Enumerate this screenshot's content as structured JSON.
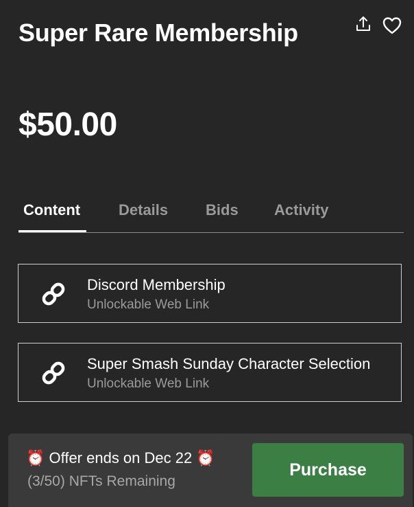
{
  "header": {
    "title": "Super Rare Membership",
    "share_icon": "share-upload-icon",
    "favorite_icon": "heart-icon"
  },
  "price": "$50.00",
  "tabs": [
    {
      "label": "Content",
      "active": true
    },
    {
      "label": "Details",
      "active": false
    },
    {
      "label": "Bids",
      "active": false
    },
    {
      "label": "Activity",
      "active": false
    }
  ],
  "content_items": [
    {
      "icon": "link-icon",
      "title": "Discord Membership",
      "subtitle": "Unlockable Web Link"
    },
    {
      "icon": "link-icon",
      "title": "Super Smash Sunday Character Selection",
      "subtitle": "Unlockable Web Link"
    }
  ],
  "footer": {
    "offer_text": "⏰ Offer ends on Dec 22 ⏰",
    "remaining_text": "(3/50) NFTs Remaining",
    "purchase_label": "Purchase"
  },
  "colors": {
    "background": "#262626",
    "footer_background": "#3a3a3a",
    "purchase_button": "#3b7f45",
    "muted_text": "#9a9a9a"
  }
}
